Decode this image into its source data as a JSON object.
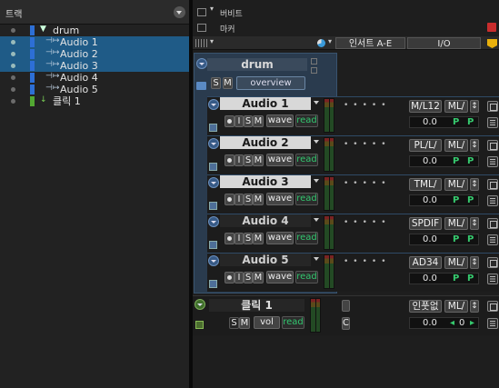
{
  "left_panel": {
    "title": "트랙",
    "tracks": [
      {
        "name": "drum",
        "selected": false,
        "color": "#2d6fd6",
        "kind": "folder"
      },
      {
        "name": "Audio 1",
        "selected": true,
        "color": "#2d6fd6",
        "kind": "audio"
      },
      {
        "name": "Audio 2",
        "selected": true,
        "color": "#2d6fd6",
        "kind": "audio"
      },
      {
        "name": "Audio 3",
        "selected": true,
        "color": "#2d6fd6",
        "kind": "audio"
      },
      {
        "name": "Audio 4",
        "selected": false,
        "color": "#2d6fd6",
        "kind": "audio"
      },
      {
        "name": "Audio 5",
        "selected": false,
        "color": "#2d6fd6",
        "kind": "audio"
      },
      {
        "name": "클릭 1",
        "selected": false,
        "color": "#52a832",
        "kind": "click"
      }
    ]
  },
  "right_panel": {
    "views": [
      {
        "label": "버비트",
        "icon": "window-icon"
      },
      {
        "label": "마커",
        "icon": "window-icon"
      }
    ],
    "column_headers": {
      "inserts": "인서트 A-E",
      "io": "I/O"
    },
    "folder": {
      "name": "drum",
      "solo": "S",
      "mute": "M",
      "overview": "overview"
    },
    "tracks": [
      {
        "name": "Audio 1",
        "highlighted": true,
        "input": "I",
        "solo": "S",
        "mute": "M",
        "wave": "wave",
        "read": "read",
        "in_io": "M/L12",
        "out_io": "ML/",
        "volume": "0.0",
        "pan_l": "P",
        "pan_r": "P"
      },
      {
        "name": "Audio 2",
        "highlighted": true,
        "input": "I",
        "solo": "S",
        "mute": "M",
        "wave": "wave",
        "read": "read",
        "in_io": "PL/L/",
        "out_io": "ML/",
        "volume": "0.0",
        "pan_l": "P",
        "pan_r": "P"
      },
      {
        "name": "Audio 3",
        "highlighted": true,
        "input": "I",
        "solo": "S",
        "mute": "M",
        "wave": "wave",
        "read": "read",
        "in_io": "TML/",
        "out_io": "ML/",
        "volume": "0.0",
        "pan_l": "P",
        "pan_r": "P"
      },
      {
        "name": "Audio 4",
        "highlighted": false,
        "input": "I",
        "solo": "S",
        "mute": "M",
        "wave": "wave",
        "read": "read",
        "in_io": "SPDIF",
        "out_io": "ML/",
        "volume": "0.0",
        "pan_l": "P",
        "pan_r": "P"
      },
      {
        "name": "Audio 5",
        "highlighted": false,
        "input": "I",
        "solo": "S",
        "mute": "M",
        "wave": "wave",
        "read": "read",
        "in_io": "AD34",
        "out_io": "ML/",
        "volume": "0.0",
        "pan_l": "P",
        "pan_r": "P"
      }
    ],
    "click_track": {
      "name": "클릭 1",
      "solo": "S",
      "mute": "M",
      "vol": "vol",
      "read": "read",
      "c_label": "C",
      "in_io": "인풋없",
      "out_io": "ML/",
      "volume": "0.0",
      "pan": "0"
    }
  }
}
